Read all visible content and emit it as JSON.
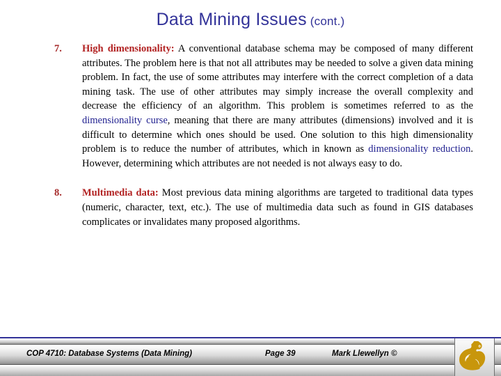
{
  "slide": {
    "title_main": "Data Mining Issues",
    "title_suffix": "(cont.)",
    "title_color": "#333399"
  },
  "items": [
    {
      "number": "7.",
      "lead": "High dimensionality:",
      "body_1": " A conventional database schema may be composed of many different attributes.  The problem here is that not all attributes may be needed to solve a given data mining problem.  In fact, the use of some attributes may interfere with the correct completion of a data mining task.  The use of other attributes may simply increase the overall complexity and decrease the efficiency of an algorithm.  This problem is sometimes referred to as the ",
      "term_1": "dimensionality curse",
      "body_2": ", meaning that there are many attributes (dimensions) involved and it is difficult to determine which ones should be used.  One solution to this high dimensionality problem is to reduce the number of attributes, which in known as ",
      "term_2": "dimensionality reduction",
      "body_3": ".  However, determining which attributes are not needed is not always easy to do."
    },
    {
      "number": "8.",
      "lead": "Multimedia data:",
      "body_1": " Most previous data mining algorithms are targeted to traditional data types (numeric, character, text, etc.).  The use of multimedia data such as found in GIS databases complicates or invalidates many proposed algorithms.",
      "term_1": "",
      "body_2": "",
      "term_2": "",
      "body_3": ""
    }
  ],
  "footer": {
    "course": "COP 4710: Database Systems  (Data Mining)",
    "page": "Page 39",
    "author": "Mark Llewellyn ©",
    "logo_name": "ucf-pegasus-logo",
    "logo_color": "#c8960c"
  }
}
